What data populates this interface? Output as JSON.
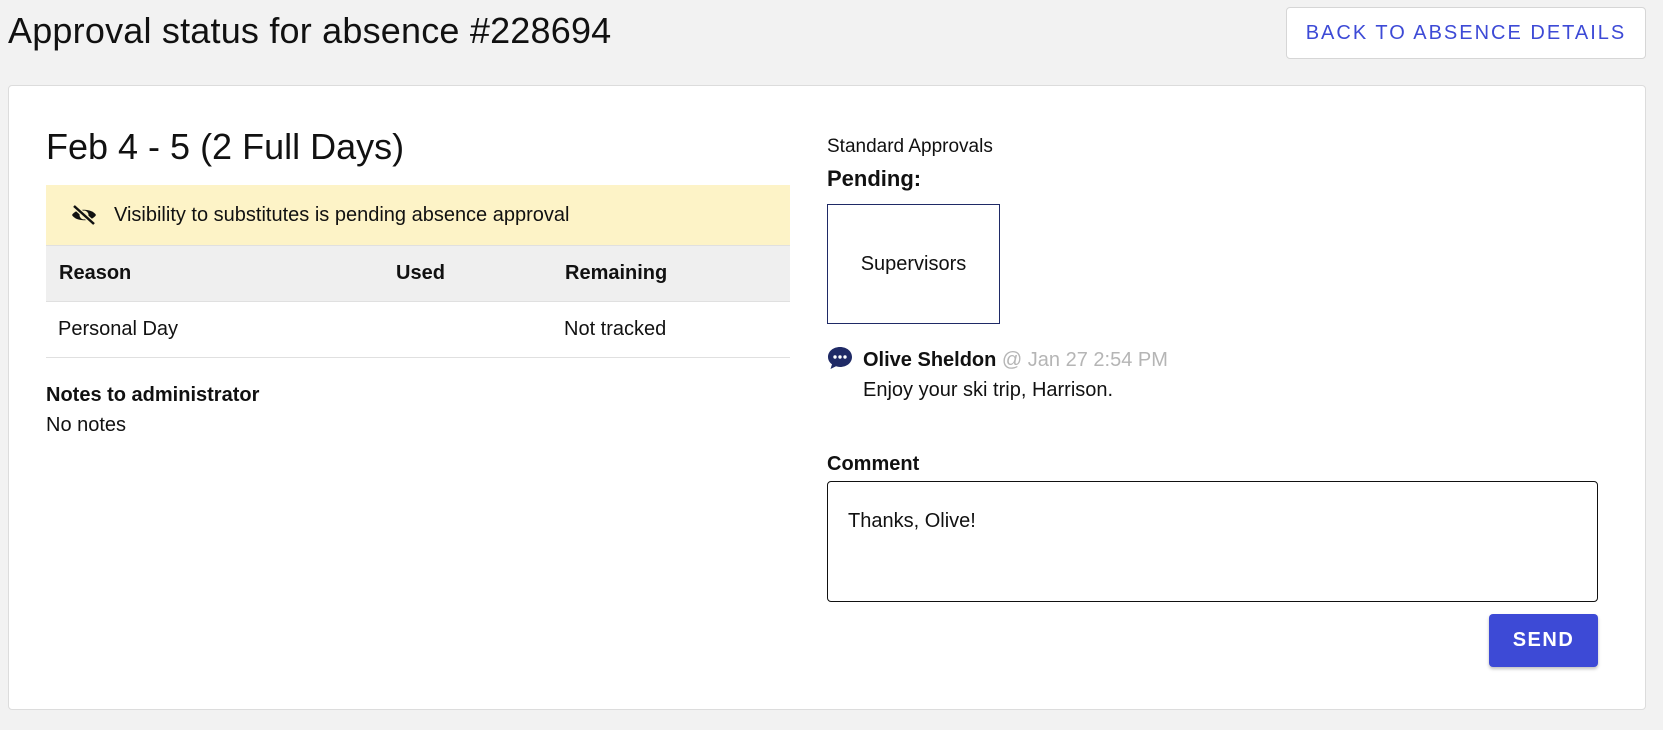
{
  "header": {
    "title": "Approval status for absence #228694",
    "back_button_label": "BACK TO ABSENCE DETAILS"
  },
  "absence": {
    "date_range": "Feb 4 - 5 (2 Full Days)",
    "visibility_notice": "Visibility to substitutes is pending absence approval",
    "table": {
      "headers": [
        "Reason",
        "Used",
        "Remaining"
      ],
      "rows": [
        [
          "Personal Day",
          "",
          "Not tracked"
        ]
      ]
    },
    "notes_label": "Notes to administrator",
    "notes_value": "No notes"
  },
  "approvals": {
    "title": "Standard Approvals",
    "pending_label": "Pending:",
    "pending_approvers": [
      "Supervisors"
    ]
  },
  "comments": [
    {
      "author": "Olive Sheldon",
      "timestamp": "@ Jan 27 2:54 PM",
      "text": "Enjoy your ski trip, Harrison."
    }
  ],
  "comment_form": {
    "label": "Comment",
    "value": "Thanks, Olive!",
    "send_label": "SEND"
  },
  "colors": {
    "accent": "#3d4ad6",
    "banner_bg": "#fdf3c7",
    "approver_border": "#1f2a66",
    "chat_icon": "#1f2a66"
  },
  "icons": {
    "visibility": "eye-off-icon",
    "comment": "chat-bubble-icon"
  }
}
